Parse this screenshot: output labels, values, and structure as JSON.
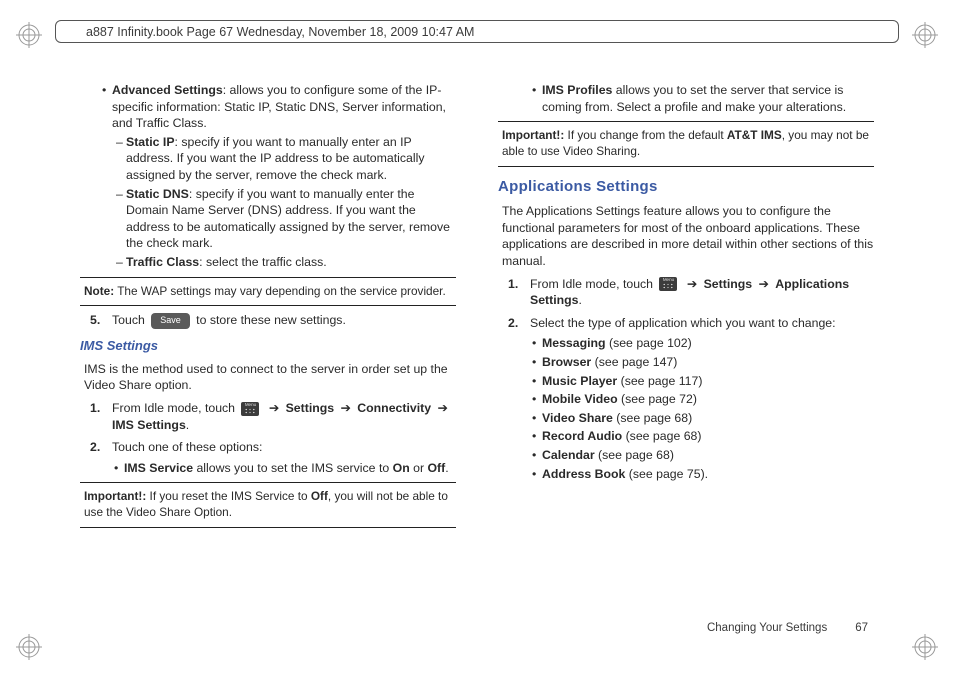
{
  "header": {
    "text": "a887 Infinity.book  Page 67  Wednesday, November 18, 2009  10:47 AM"
  },
  "left": {
    "adv": {
      "title": "Advanced Settings",
      "desc": ": allows you to configure some of the IP-specific information: Static IP, Static DNS, Server information, and Traffic Class.",
      "static_ip_t": "Static IP",
      "static_ip_d": ": specify if you want to manually enter an IP address. If you want the IP address to be automatically assigned by the server, remove the check mark.",
      "static_dns_t": "Static DNS",
      "static_dns_d": ": specify if you want to manually enter the Domain Name Server (DNS) address. If you want the address to be automatically assigned by the server, remove the check mark.",
      "traffic_t": "Traffic Class",
      "traffic_d": ": select the traffic class."
    },
    "note_wap": {
      "label": "Note:",
      "text": " The WAP settings may vary depending on the service provider."
    },
    "step5": {
      "num": "5.",
      "pre": "Touch ",
      "key": "Save",
      "post": " to store these new settings."
    },
    "ims_hdr": "IMS Settings",
    "ims_intro": "IMS is the method used to connect to the server in order set up the Video Share option.",
    "ims1": {
      "num": "1.",
      "pre": "From Idle mode, touch ",
      "arrow": "➔",
      "settings": "Settings",
      "conn": "Connectivity",
      "ims": "IMS Settings"
    },
    "ims2": {
      "num": "2.",
      "text": "Touch one of these options:"
    },
    "ims_service": {
      "t": "IMS Service",
      "d": " allows you to set the IMS service to ",
      "on": "On",
      "or": " or ",
      "off": "Off",
      "dot": "."
    },
    "important_ims": {
      "label": "Important!:",
      "pre": " If you reset the IMS Service to ",
      "off": "Off",
      "post": ", you will not be able to use the Video Share Option."
    }
  },
  "right": {
    "ims_profiles": {
      "t": "IMS Profiles",
      "d": " allows you to set the server that service is coming from. Select a profile and make your alterations."
    },
    "important_att": {
      "label": "Important!:",
      "pre": " If you change from the default ",
      "att": "AT&T IMS",
      "post": ", you may not be able to use Video Sharing."
    },
    "apps_hdr": "Applications Settings",
    "apps_intro": "The Applications Settings feature allows you to configure the functional parameters for most of the onboard applications. These applications are described in more detail within other sections of this manual.",
    "app1": {
      "num": "1.",
      "pre": "From Idle mode, touch ",
      "arrow": "➔",
      "settings": "Settings",
      "apps": "Applications Settings"
    },
    "app2": {
      "num": "2.",
      "text": "Select the type of application which you want to change:"
    },
    "list": [
      {
        "t": "Messaging",
        "p": " (see page 102)"
      },
      {
        "t": "Browser",
        "p": " (see page 147)"
      },
      {
        "t": "Music Player",
        "p": " (see page 117)"
      },
      {
        "t": "Mobile Video",
        "p": " (see page 72)"
      },
      {
        "t": "Video Share",
        "p": " (see page 68)"
      },
      {
        "t": "Record Audio",
        "p": " (see page 68)"
      },
      {
        "t": "Calendar",
        "p": " (see page 68)"
      },
      {
        "t": "Address Book",
        "p": " (see page 75)."
      }
    ]
  },
  "footer": {
    "section": "Changing Your Settings",
    "page": "67"
  }
}
